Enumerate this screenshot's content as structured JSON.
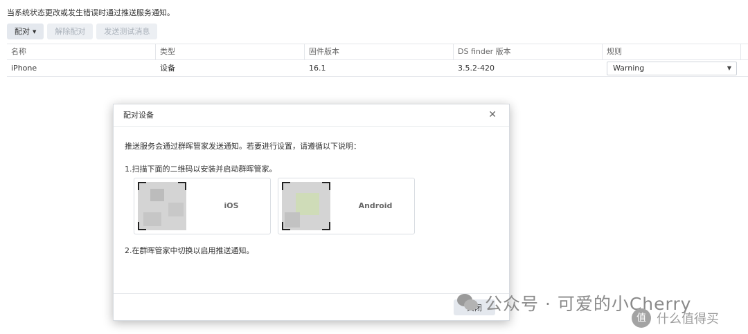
{
  "intro": "当系统状态更改或发生错误时通过推送服务通知。",
  "toolbar": {
    "pair_label": "配对",
    "unpair_label": "解除配对",
    "test_label": "发送测试消息"
  },
  "table": {
    "headers": [
      "名称",
      "类型",
      "固件版本",
      "DS finder 版本",
      "规则"
    ],
    "rows": [
      {
        "name": "iPhone",
        "type": "设备",
        "firmware": "16.1",
        "finder": "3.5.2-420",
        "rule": "Warning"
      }
    ]
  },
  "dialog": {
    "title": "配对设备",
    "close_icon": "close-icon",
    "line1": "推送服务会通过群晖管家发送通知。若要进行设置，请遵循以下说明：",
    "line2": "1.扫描下面的二维码以安装并启动群晖管家。",
    "ios_label": "iOS",
    "android_label": "Android",
    "line3": "2.在群晖管家中切换以启用推送通知。",
    "close_button": "关闭"
  },
  "watermarks": {
    "wechat": "公众号 · 可爱的小Cherry",
    "smzdm": "什么值得买",
    "smzdm_logo_text": "值"
  }
}
